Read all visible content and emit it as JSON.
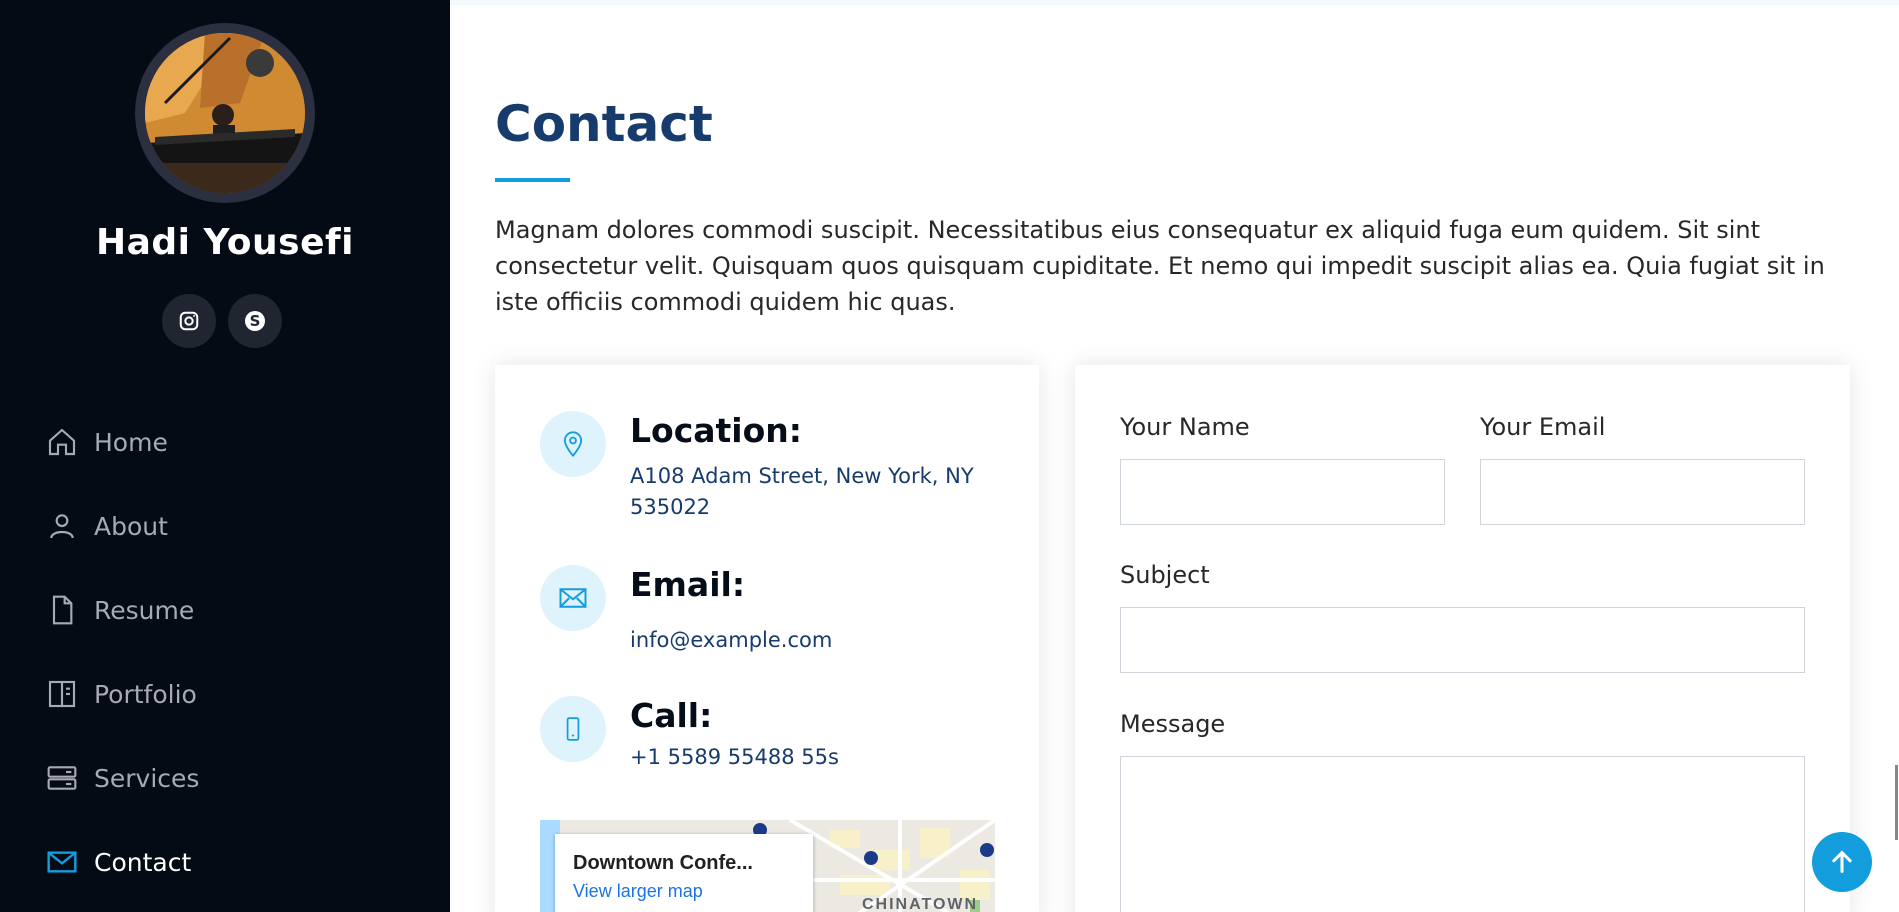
{
  "profile": {
    "name": "Hadi Yousefi"
  },
  "social": [
    {
      "icon": "instagram-icon"
    },
    {
      "icon": "skype-icon"
    }
  ],
  "nav": [
    {
      "label": "Home",
      "icon": "home-icon"
    },
    {
      "label": "About",
      "icon": "person-icon"
    },
    {
      "label": "Resume",
      "icon": "file-icon"
    },
    {
      "label": "Portfolio",
      "icon": "book-half-icon"
    },
    {
      "label": "Services",
      "icon": "server-icon"
    },
    {
      "label": "Contact",
      "icon": "envelope-icon",
      "active": true
    }
  ],
  "contact": {
    "title": "Contact",
    "intro": "Magnam dolores commodi suscipit. Necessitatibus eius consequatur ex aliquid fuga eum quidem. Sit sint consectetur velit. Quisquam quos quisquam cupiditate. Et nemo qui impedit suscipit alias ea. Quia fugiat sit in iste officiis commodi quidem hic quas.",
    "location": {
      "heading": "Location:",
      "text": "A108 Adam Street, New York, NY 535022"
    },
    "email": {
      "heading": "Email:",
      "text": "info@example.com"
    },
    "call": {
      "heading": "Call:",
      "text": "+1 5589 55488 55s"
    },
    "map": {
      "place": "Downtown Confe...",
      "link": "View larger map",
      "area_label": "CHINATOWN"
    }
  },
  "form": {
    "name_label": "Your Name",
    "name_value": "",
    "email_label": "Your Email",
    "email_value": "",
    "subject_label": "Subject",
    "subject_value": "",
    "message_label": "Message",
    "message_value": ""
  },
  "colors": {
    "sidebar_bg": "#040b14",
    "accent": "#149ddd",
    "heading": "#173b6c"
  }
}
